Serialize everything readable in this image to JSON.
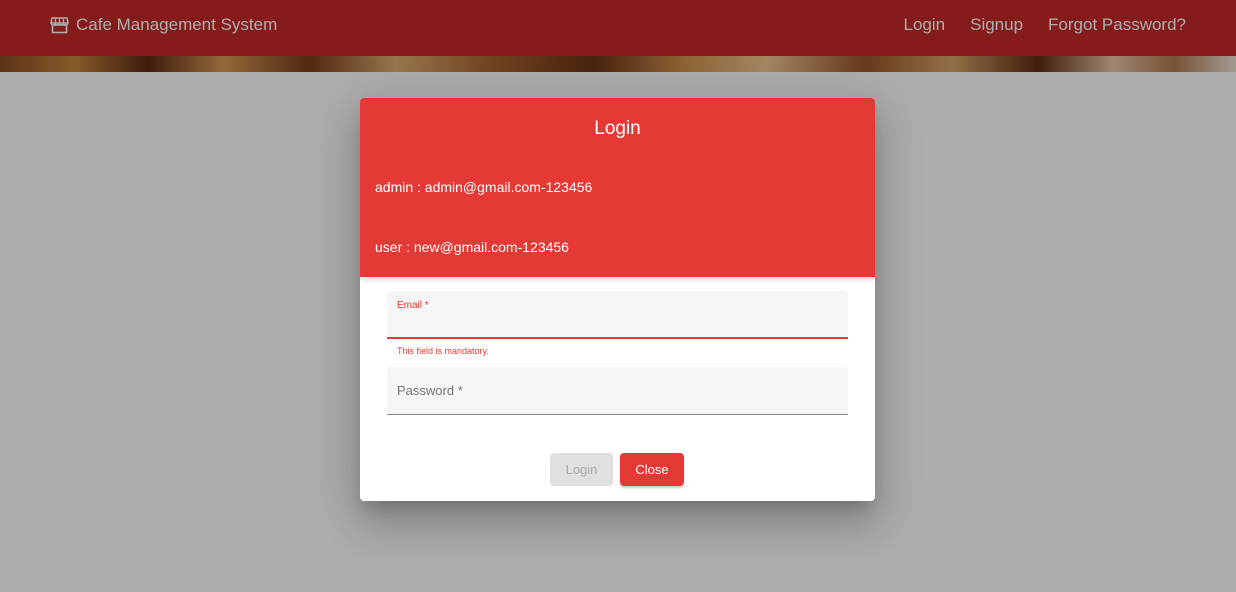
{
  "navbar": {
    "brand_icon": "store-icon",
    "brand_title": "Cafe Management System",
    "links": {
      "login": "Login",
      "signup": "Signup",
      "forgot_password": "Forgot Password?"
    }
  },
  "dialog": {
    "title": "Login",
    "credentials": {
      "admin": "admin : admin@gmail.com-123456",
      "user": "user : new@gmail.com-123456"
    },
    "email_field": {
      "label": "Email *",
      "value": "",
      "error": "This field is mandatory."
    },
    "password_field": {
      "placeholder": "Password *",
      "value": ""
    },
    "buttons": {
      "login": "Login",
      "close": "Close"
    }
  },
  "colors": {
    "navbar": "#c62828",
    "header": "#e53935",
    "error": "#e53935",
    "disabled_button": "#e0e0e0"
  }
}
